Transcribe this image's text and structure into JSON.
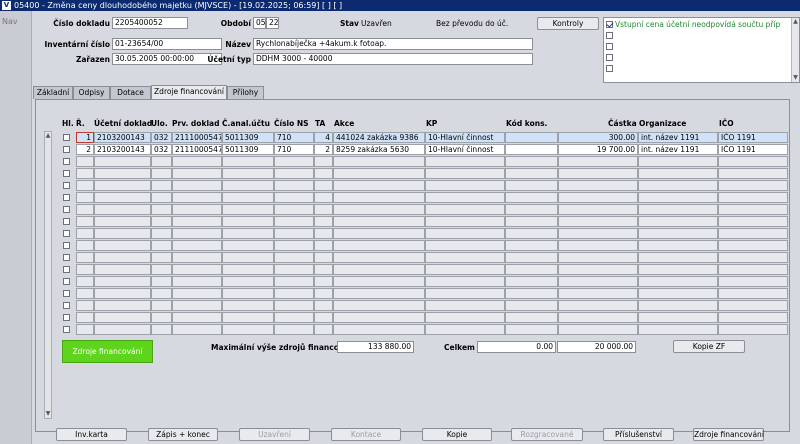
{
  "window": {
    "title": "05400 - Změna ceny dlouhodobého majetku (MJVSCE) - [19.02.2025; 06:59]  [ ]  [ ]",
    "nav_label": "Nav"
  },
  "header": {
    "cislo_dokladu_label": "Číslo dokladu",
    "cislo_dokladu": "2205400052",
    "obdobi_label": "Období",
    "obdobi_month": "05",
    "obdobi_year": "22",
    "stav_label": "Stav",
    "stav_value": "Uzavřen",
    "prevod_text": "Bez převodu do úč.",
    "kontroly_label": "Kontroly",
    "inventarni_label": "Inventární číslo",
    "inventarni_value": "01-23654/00",
    "nazev_label": "Název",
    "nazev_value": "Rychlonabíječka +4akum.k fotoap.",
    "zarazen_label": "Zařazen",
    "zarazen_value": "30.05.2005 00:00:00",
    "ucetni_typ_label": "Účetní typ",
    "ucetni_typ_value": "DDHM 3000 - 40000"
  },
  "messages": {
    "items": [
      {
        "checked": true,
        "text": "Vstupní cena účetní neodpovídá součtu příp"
      },
      {
        "checked": false,
        "text": ""
      },
      {
        "checked": false,
        "text": ""
      },
      {
        "checked": false,
        "text": ""
      },
      {
        "checked": false,
        "text": ""
      }
    ]
  },
  "tabs": [
    {
      "label": "Základní",
      "active": false
    },
    {
      "label": "Odpisy",
      "active": false
    },
    {
      "label": "Dotace",
      "active": false
    },
    {
      "label": "Zdroje financování",
      "active": true
    },
    {
      "label": "Přílohy",
      "active": false
    }
  ],
  "grid": {
    "columns": {
      "hl": "Hl.",
      "r": "Ř.",
      "ucetni_doklad": "Účetní doklad",
      "ulo": "Ulo.",
      "prv_doklad": "Prv. doklad",
      "c_anal": "Č.anal.účtu",
      "cislo_ns": "Číslo NS",
      "ta": "TA",
      "akce": "Akce",
      "kp": "KP",
      "kod_kons": "Kód kons.",
      "castka": "Částka",
      "organizace": "Organizace",
      "ico": "IČO"
    },
    "rows": [
      {
        "r": "1",
        "ucetni_doklad": "2103200143",
        "ulo": "032",
        "prv_doklad": "2111000547",
        "c_anal": "5011309",
        "cislo_ns": "710",
        "ta": "4",
        "akce": "441024 zakázka 9386",
        "kp": "10-Hlavní činnost",
        "kod_kons": "",
        "castka": "300.00",
        "organizace": "int. název 1191",
        "ico": "IČO 1191"
      },
      {
        "r": "2",
        "ucetni_doklad": "2103200143",
        "ulo": "032",
        "prv_doklad": "2111000547",
        "c_anal": "5011309",
        "cislo_ns": "710",
        "ta": "2",
        "akce": "8259 zakázka 5630",
        "kp": "10-Hlavní činnost",
        "kod_kons": "",
        "castka": "19 700.00",
        "organizace": "int. název 1191",
        "ico": "IČO 1191"
      }
    ]
  },
  "summary": {
    "green_button_label": "Zdroje financování",
    "max_label": "Maximální výše zdrojů financování",
    "max_value": "133 880.00",
    "celkem_label": "Celkem",
    "celkem_value1": "0.00",
    "celkem_value2": "20 000.00",
    "kopie_zf_label": "Kopie ZF"
  },
  "bottom_buttons": [
    {
      "label": "Inv.karta",
      "enabled": true
    },
    {
      "label": "Zápis + konec",
      "enabled": true
    },
    {
      "label": "Uzavření",
      "enabled": false
    },
    {
      "label": "Kontace",
      "enabled": false
    },
    {
      "label": "Kopie",
      "enabled": true
    },
    {
      "label": "Rozgracované",
      "enabled": false
    },
    {
      "label": "Příslušenství",
      "enabled": true
    },
    {
      "label": "Zdroje financování",
      "enabled": true
    }
  ]
}
